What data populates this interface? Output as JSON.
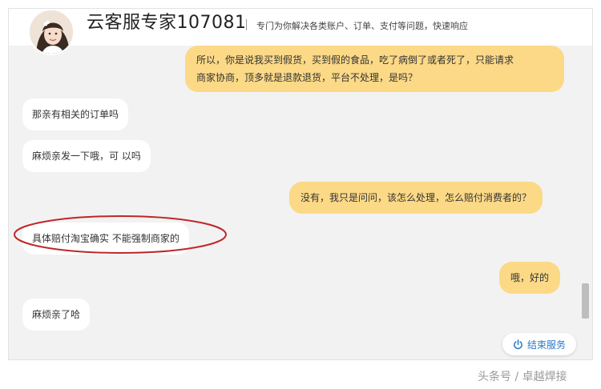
{
  "header": {
    "title": "云客服专家107081",
    "subtitle": "专门为你解决各类账户、订单、支付等问题，快速响应"
  },
  "messages": [
    {
      "side": "right",
      "lines": [
        "所以，你是说我买到假货，买到假的食品，吃了病倒了或者死了，只能请求",
        "商家协商，顶多就是退款退货，平台不处理，是吗？"
      ]
    },
    {
      "side": "left",
      "text": "那亲有相关的订单吗"
    },
    {
      "side": "left",
      "text": "麻烦亲发一下哦，可 以吗"
    },
    {
      "side": "right",
      "text": "没有，我只是问问，该怎么处理，怎么赔付消费者的？"
    },
    {
      "side": "left",
      "text": "具体赔付淘宝确实 不能强制商家的"
    },
    {
      "side": "right",
      "text": "哦，好的"
    },
    {
      "side": "left",
      "text": "麻烦亲了哈"
    }
  ],
  "end_service_label": "结束服务",
  "watermark": "头条号 / 卓越焊接",
  "colors": {
    "user_bubble": "#fcd986",
    "agent_bubble": "#ffffff",
    "annotation_circle": "#c0262b",
    "end_button_text": "#2a78c6"
  },
  "icons": {
    "end_service": "power-icon"
  }
}
